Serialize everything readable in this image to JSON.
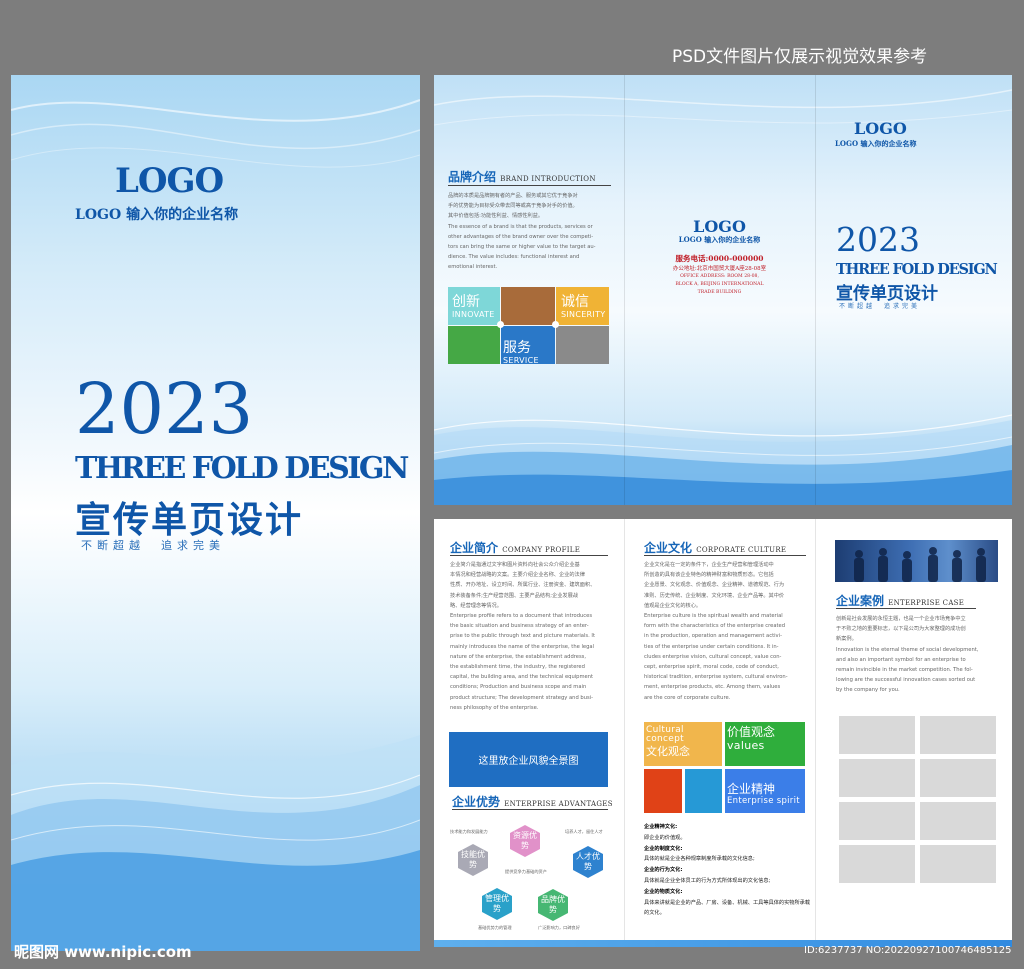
{
  "top_caption": "PSD文件图片仅展示视觉效果参考",
  "cover": {
    "logo": "LOGO",
    "company": "LOGO 输入你的企业名称",
    "year": "2023",
    "title_en": "THREE FOLD DESIGN",
    "title_cn": "宣传单页设计",
    "slogan": "不断超越　追求完美"
  },
  "outer": {
    "brand": {
      "heading": "品牌介绍",
      "heading_en": "BRAND INTRODUCTION",
      "cn_lines": [
        "品牌的本质是品牌拥有者的产品、服务或其它优于竞争对",
        "手的优势能为目标受众带去同等或高于竞争对手的价值。",
        "其中价值包括:功能性利益、情感性利益。"
      ],
      "en_lines": [
        "The essence of a brand is that the products, services or",
        "other advantages of the brand owner over the competi-",
        "tors can bring the same or higher value to the target au-",
        "dience. The value includes: functional interest and",
        "emotional interest."
      ],
      "tiles": [
        {
          "cn": "创新",
          "en": "INNOVATE",
          "color": "#7ed7d8"
        },
        {
          "cn": "",
          "en": "",
          "color": "#a86b3a"
        },
        {
          "cn": "诚信",
          "en": "SINCERITY",
          "color": "#f0b335"
        },
        {
          "cn": "",
          "en": "",
          "color": "#45a845"
        },
        {
          "cn": "服务",
          "en": "SERVICE",
          "color": "#2a78c8"
        },
        {
          "cn": "",
          "en": "",
          "color": "#8a8a8a"
        }
      ]
    },
    "back": {
      "logo": "LOGO",
      "company": "LOGO 输入你的企业名称",
      "phone": "服务电话:0000-000000",
      "address_cn": "办公地址:北京市国贸大厦A座28-08室",
      "address_en": [
        "OFFICE ADDRESS: ROOM 28-08,",
        "BLOCK A, BEIJING INTERNATIONAL",
        "TRADE BUILDING"
      ]
    },
    "front": {
      "logo": "LOGO",
      "company": "LOGO 输入你的企业名称",
      "year": "2023",
      "title_en": "THREE FOLD DESIGN",
      "title_cn": "宣传单页设计",
      "slogan": "不断超越　追求完美"
    }
  },
  "inner": {
    "profile": {
      "heading": "企业简介",
      "heading_en": "COMPANY PROFILE",
      "cn_lines": [
        "企业简介是指通过文字和图片资料向社会公众介绍企业基",
        "本情况和经营战略的文案。主要介绍企业名称、企业的法律",
        "性质、开办地址、设立时间、所属行业、注册资金、建筑面积、",
        "技术装备条件;生产经营范围、主要产品结构;企业发展战",
        "略、经营理念等情况。"
      ],
      "en_lines": [
        "Enterprise profile refers to a document that introduces",
        "the basic situation and business strategy of an enter-",
        "prise to the public through text and picture materials. It",
        "mainly introduces the name of the enterprise, the legal",
        "nature of the enterprise, the establishment address,",
        "the establishment time, the industry, the registered",
        "capital, the building area, and the technical equipment",
        "conditions; Production and business scope and main",
        "product structure; The development strategy and busi-",
        "ness philosophy of the enterprise."
      ],
      "banner": "这里放企业风貌全景图"
    },
    "advantages": {
      "heading": "企业优势",
      "heading_en": "ENTERPRISE ADVANTAGES",
      "hexes": [
        {
          "label": "技能优势",
          "color": "#a9a9b5"
        },
        {
          "label": "资源优势",
          "color": "#e191c9"
        },
        {
          "label": "人才优势",
          "color": "#2e82cf"
        },
        {
          "label": "管理优势",
          "color": "#2aa1c9"
        },
        {
          "label": "品牌优势",
          "color": "#46b773"
        }
      ],
      "notes": [
        "技术能力和发展能力",
        "培养人才，留住人才",
        "提供竞争力基础的资产",
        "基础优势力的管理",
        "广泛影响力，口碑良好"
      ]
    },
    "culture": {
      "heading": "企业文化",
      "heading_en": "CORPORATE CULTURE",
      "cn_lines": [
        "企业文化是在一定的条件下，企业生产经营和管理活动中",
        "所创造的具有该企业特色的精神财富和物质形态。它包括",
        "企业愿景、文化观念、价值观念、企业精神、道德规范、行为",
        "准则、历史传统、企业制度、文化环境、企业产品等。其中价",
        "值观是企业文化的核心。"
      ],
      "en_lines": [
        "Enterprise culture is the spiritual wealth and material",
        "form with the characteristics of the enterprise created",
        "in the production, operation and management activi-",
        "ties of the enterprise under certain conditions. It in-",
        "cludes enterprise vision, cultural concept, value con-",
        "cept, enterprise spirit, moral code, code of conduct,",
        "historical tradition, enterprise system, cultural environ-",
        "ment, enterprise products, etc. Among them, values",
        "are the core of corporate culture."
      ],
      "tiles": [
        {
          "en": "Cultural concept",
          "cn": "文化观念",
          "color": "#f1b64c"
        },
        {
          "en": "values",
          "cn": "价值观念",
          "color": "#2fae3c"
        },
        {
          "en": "",
          "cn": "",
          "color": "#e04217"
        },
        {
          "en": "",
          "cn": "",
          "color": "#2699d6"
        },
        {
          "en": "Enterprise spirit",
          "cn": "企业精神",
          "color": "#3b7ee8"
        }
      ],
      "items": [
        {
          "title": "企业精神文化:",
          "text": "即企业的价值观。"
        },
        {
          "title": "企业的制度文化:",
          "text": "具体的就是企业各种规章制度所承载的文化信息;"
        },
        {
          "title": "企业的行为文化:",
          "text": "具体就是企业全体员工的行为方式所体现出的文化信息;"
        },
        {
          "title": "企业的物质文化:",
          "text": "具体来讲就是企业的产品、厂房、设备、机械、工具等具体的实物所承载的文化。"
        }
      ]
    },
    "cases": {
      "heading": "企业案例",
      "heading_en": "ENTERPRISE CASE",
      "cn_lines": [
        "创新是社会发展的永恒主题，也是一个企业市场竞争中立",
        "于不败之地的重要标志，以下是公司为大家整理的成功创",
        "新案例。"
      ],
      "en_lines": [
        "Innovation is the eternal theme of social development,",
        "and also an important symbol for an enterprise to",
        "remain invincible in the market competition. The fol-",
        "lowing are the successful innovation cases sorted out",
        "by the company for you."
      ]
    }
  },
  "watermark": {
    "site": "昵图网 www.nipic.com",
    "id": "ID:6237737 NO:20220927100746485125"
  }
}
